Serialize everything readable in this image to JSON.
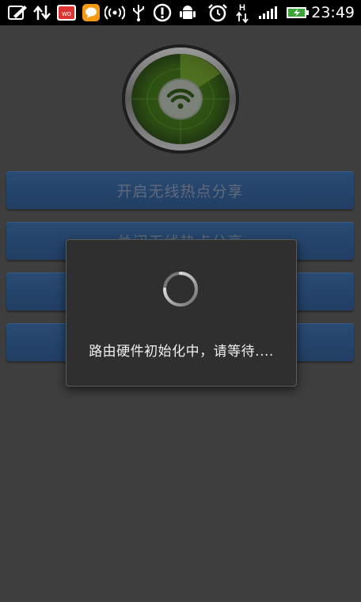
{
  "status_bar": {
    "time": "23:49",
    "icons": [
      "edit-icon",
      "sync-arrows-icon",
      "wo-app-icon",
      "chat-bubble-icon",
      "wifi-hotspot-icon",
      "usb-icon",
      "alert-icon",
      "android-debug-icon",
      "alarm-icon",
      "h-network-icon",
      "signal-icon",
      "battery-charging-icon"
    ]
  },
  "app": {
    "logo_icon": "radar-wifi-icon",
    "buttons": [
      {
        "label": "开启无线热点分享"
      },
      {
        "label": "关闭无线热点分享"
      },
      {
        "label": ""
      },
      {
        "label": ""
      }
    ]
  },
  "dialog": {
    "message": "路由硬件初始化中，请等待....",
    "spinner_icon": "loading-spinner-icon"
  },
  "colors": {
    "background": "#4a4a4a",
    "button": "#245594",
    "button_text": "#7c8ea6",
    "radar_green": "#4c8a12",
    "dialog_bg": "#2f2f2f"
  }
}
